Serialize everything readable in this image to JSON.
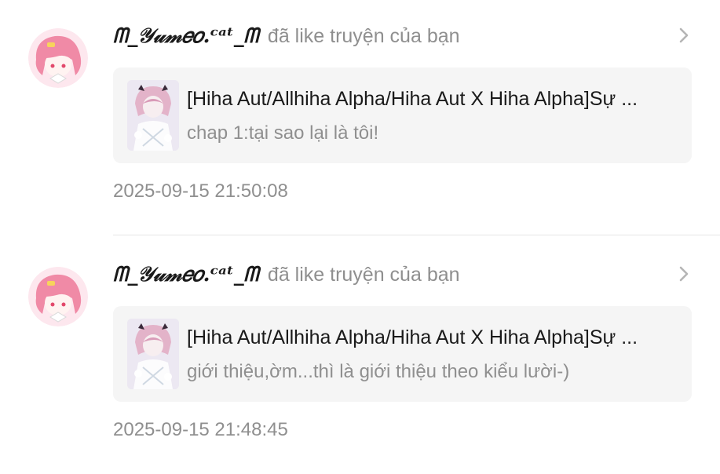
{
  "notifications": [
    {
      "username": "ᗰ_𝒴𝓊𝓂𝑒𝑜.ᶜᵃᵗ_ᗰ",
      "action": "đã like truyện của bạn",
      "story_title": "[Hiha Aut/Allhiha Alpha/Hiha Aut X Hiha Alpha]Sự ...",
      "chapter": "chap 1:tại sao lại là tôi!",
      "timestamp": "2025-09-15 21:50:08",
      "chevron_icon": "chevron-right-icon"
    },
    {
      "username": "ᗰ_𝒴𝓊𝓂𝑒𝑜.ᶜᵃᵗ_ᗰ",
      "action": "đã like truyện của bạn",
      "story_title": "[Hiha Aut/Allhiha Alpha/Hiha Aut X Hiha Alpha]Sự ...",
      "chapter": "giới thiệu,ờm...thì là giới thiệu theo kiểu lười-)",
      "timestamp": "2025-09-15 21:48:45",
      "chevron_icon": "chevron-right-icon"
    }
  ],
  "colors": {
    "card_background": "#f5f5f5",
    "muted_text": "#8f8f8f",
    "avatar_hair": "#f08aa6"
  }
}
